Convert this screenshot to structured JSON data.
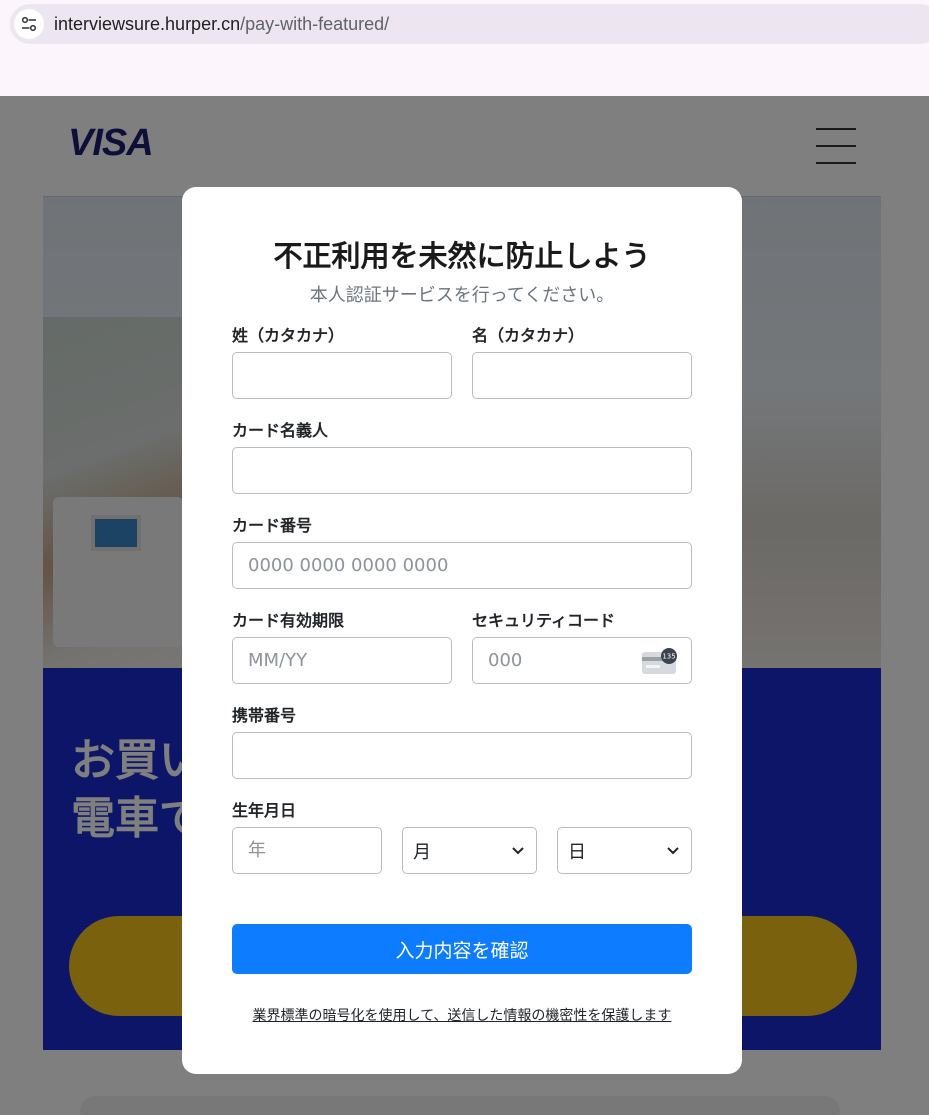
{
  "browser": {
    "url_host": "interviewsure.hurper.cn",
    "url_path": "/pay-with-featured/"
  },
  "page": {
    "logo_text": "VISA",
    "banner_line1": "お買い",
    "banner_line2": "電車で"
  },
  "modal": {
    "title": "不正利用を未然に防止しよう",
    "subtitle": "本人認証サービスを行ってください。",
    "fields": {
      "last_name_label": "姓（カタカナ）",
      "first_name_label": "名（カタカナ）",
      "card_holder_label": "カード名義人",
      "card_number_label": "カード番号",
      "card_number_placeholder": "0000 0000 0000 0000",
      "expiry_label": "カード有効期限",
      "expiry_placeholder": "MM/YY",
      "security_label": "セキュリティコード",
      "security_placeholder": "000",
      "security_icon_badge": "135",
      "phone_label": "携帯番号",
      "birthdate_label": "生年月日",
      "year_placeholder": "年",
      "month_selected": "月",
      "day_selected": "日"
    },
    "submit_label": "入力内容を確認",
    "footer_note": "業界標準の暗号化を使用して、送信した情報の機密性を保護します"
  },
  "colors": {
    "primary_button": "#0d7cff",
    "visa_blue": "#1a1f71",
    "banner_blue": "#1a2bd0",
    "banner_yellow": "#f2c21a"
  },
  "icons": [
    "site-settings-icon",
    "hamburger-menu-icon",
    "card-cvv-icon",
    "chevron-down-icon"
  ]
}
